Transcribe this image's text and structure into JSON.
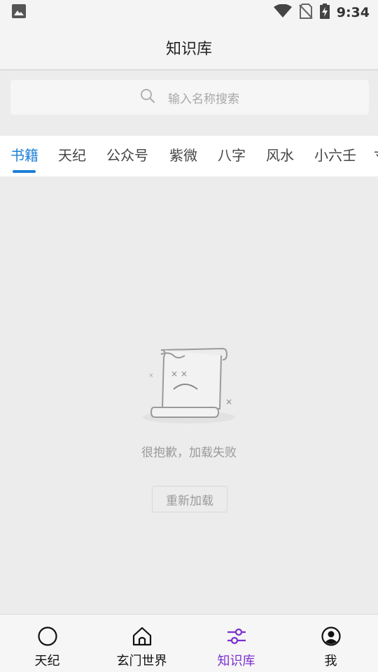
{
  "status_bar": {
    "time": "9:34",
    "icons": [
      "image-notification-icon",
      "wifi-icon",
      "no-sim-icon",
      "battery-charging-icon"
    ]
  },
  "app_bar": {
    "title": "知识库"
  },
  "search": {
    "placeholder": "输入名称搜索",
    "icon": "search-icon"
  },
  "tabs": [
    {
      "label": "书籍",
      "active": true
    },
    {
      "label": "天纪"
    },
    {
      "label": "公众号"
    },
    {
      "label": "紫微"
    },
    {
      "label": "八字"
    },
    {
      "label": "风水"
    },
    {
      "label": "小六壬"
    },
    {
      "label": "寸"
    }
  ],
  "empty_state": {
    "message": "很抱歉，加载失败",
    "reload_label": "重新加载",
    "illustration": "sad-scroll-illustration"
  },
  "bottom_nav": [
    {
      "label": "天纪",
      "icon": "circle-icon"
    },
    {
      "label": "玄门世界",
      "icon": "home-icon"
    },
    {
      "label": "知识库",
      "icon": "sliders-icon",
      "active": true
    },
    {
      "label": "我",
      "icon": "user-circle-icon"
    }
  ],
  "colors": {
    "accent_tab": "#1a7fd6",
    "accent_nav": "#7a2fd0",
    "background": "#ececec"
  }
}
